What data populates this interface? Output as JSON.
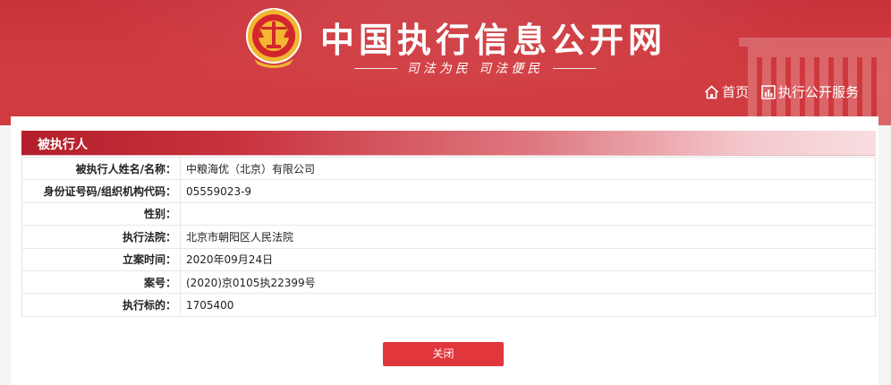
{
  "header": {
    "site_title": "中国执行信息公开网",
    "slogan": "司法为民   司法便民",
    "nav": [
      {
        "label": "首页",
        "icon": "home-icon"
      },
      {
        "label": "执行公开服务",
        "icon": "chart-icon"
      }
    ]
  },
  "section": {
    "title": "被执行人"
  },
  "rows": [
    {
      "label": "被执行人姓名/名称：",
      "value": "中粮海优（北京）有限公司"
    },
    {
      "label": "身份证号码/组织机构代码：",
      "value": "05559023-9"
    },
    {
      "label": "性别：",
      "value": ""
    },
    {
      "label": "执行法院：",
      "value": "北京市朝阳区人民法院"
    },
    {
      "label": "立案时间：",
      "value": "2020年09月24日"
    },
    {
      "label": "案号：",
      "value": "(2020)京0105执22399号"
    },
    {
      "label": "执行标的：",
      "value": "1705400"
    }
  ],
  "close_label": "关闭",
  "colors": {
    "header_red": "#cf3b3f",
    "button_red": "#e0363c",
    "section_red": "#b21f2a"
  }
}
